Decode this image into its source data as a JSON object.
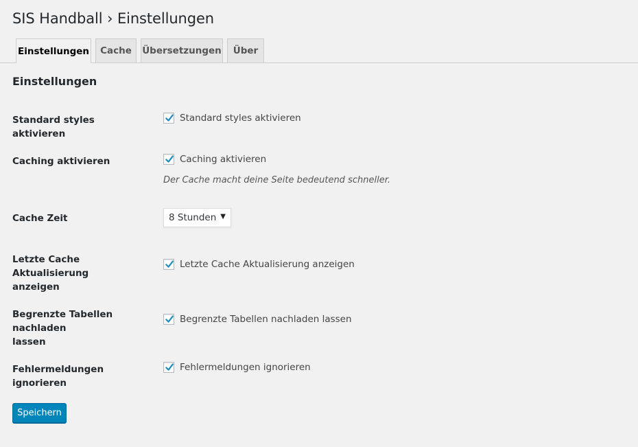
{
  "header": {
    "title": "SIS Handball › Einstellungen"
  },
  "tabs": [
    {
      "label": "Einstellungen",
      "active": true
    },
    {
      "label": "Cache",
      "active": false
    },
    {
      "label": "Übersetzungen",
      "active": false
    },
    {
      "label": "Über",
      "active": false
    }
  ],
  "section": {
    "title": "Einstellungen"
  },
  "settings": {
    "standard_styles": {
      "label": "Standard styles aktivieren",
      "checkbox_label": "Standard styles aktivieren",
      "checked": true
    },
    "caching": {
      "label": "Caching aktivieren",
      "checkbox_label": "Caching aktivieren",
      "checked": true,
      "description": "Der Cache macht deine Seite bedeutend schneller."
    },
    "cache_time": {
      "label": "Cache Zeit",
      "selected": "8 Stunden"
    },
    "last_update": {
      "label_line1": "Letzte Cache Aktualisierung",
      "label_line2": "anzeigen",
      "checkbox_label": "Letzte Cache Aktualisierung anzeigen",
      "checked": true
    },
    "limited_tables": {
      "label_line1": "Begrenzte Tabellen nachladen",
      "label_line2": "lassen",
      "checkbox_label": "Begrenzte Tabellen nachladen lassen",
      "checked": true
    },
    "ignore_errors": {
      "label": "Fehlermeldungen ignorieren",
      "checkbox_label": "Fehlermeldungen ignorieren",
      "checked": true
    }
  },
  "actions": {
    "save_label": "Speichern"
  },
  "colors": {
    "primary_button": "#0085ba",
    "checkmark": "#1e8cbe",
    "background": "#f1f1f1"
  },
  "icons": {
    "checkmark": "checkmark-icon",
    "dropdown": "chevron-down-icon"
  }
}
